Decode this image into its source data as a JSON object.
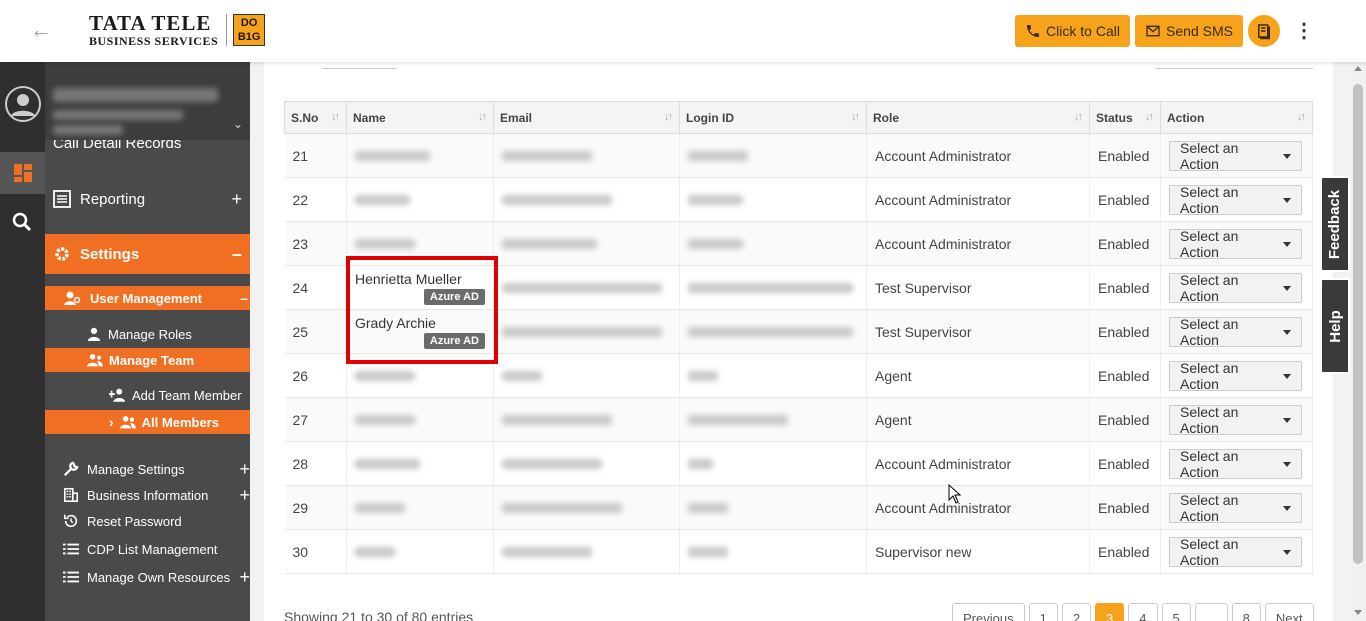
{
  "header": {
    "logo": {
      "line1": "TATA TELE",
      "line2": "BUSINESS SERVICES",
      "badge_top": "DO",
      "badge_bottom": "B1G"
    },
    "click_to_call": "Click to Call",
    "send_sms": "Send SMS",
    "accent_color": "#f7a21b"
  },
  "sidebar": {
    "partial_item": "Call Detail Records",
    "reporting": "Reporting",
    "settings": "Settings",
    "user_management": "User Management",
    "manage_roles": "Manage Roles",
    "manage_team": "Manage Team",
    "add_team_member": "Add Team Member",
    "all_members": "All Members",
    "manage_settings": "Manage Settings",
    "business_information": "Business Information",
    "reset_password": "Reset Password",
    "cdp_list_management": "CDP List Management",
    "manage_own_resources": "Manage Own Resources",
    "active_color": "#f06f22"
  },
  "table": {
    "columns": [
      "S.No",
      "Name",
      "Email",
      "Login ID",
      "Role",
      "Status",
      "Action"
    ],
    "action_label": "Select an Action",
    "badge_label": "Azure AD",
    "rows": [
      {
        "sno": "21",
        "name": "",
        "role": "Account Administrator",
        "status": "Enabled"
      },
      {
        "sno": "22",
        "name": "",
        "role": "Account Administrator",
        "status": "Enabled"
      },
      {
        "sno": "23",
        "name": "",
        "role": "Account Administrator",
        "status": "Enabled"
      },
      {
        "sno": "24",
        "name": "Henrietta Mueller",
        "role": "Test Supervisor",
        "status": "Enabled"
      },
      {
        "sno": "25",
        "name": "Grady Archie",
        "role": "Test Supervisor",
        "status": "Enabled"
      },
      {
        "sno": "26",
        "name": "",
        "role": "Agent",
        "status": "Enabled"
      },
      {
        "sno": "27",
        "name": "",
        "role": "Agent",
        "status": "Enabled"
      },
      {
        "sno": "28",
        "name": "",
        "role": "Account Administrator",
        "status": "Enabled"
      },
      {
        "sno": "29",
        "name": "",
        "role": "Account Administrator",
        "status": "Enabled"
      },
      {
        "sno": "30",
        "name": "",
        "role": "Supervisor new",
        "status": "Enabled"
      }
    ]
  },
  "footer": {
    "showing": "Showing 21 to 30 of 80 entries",
    "pages": [
      "Previous",
      "1",
      "2",
      "3",
      "4",
      "5",
      "...",
      "8",
      "Next"
    ],
    "current_page": "3"
  },
  "side_tabs": {
    "feedback": "Feedback",
    "help": "Help"
  }
}
